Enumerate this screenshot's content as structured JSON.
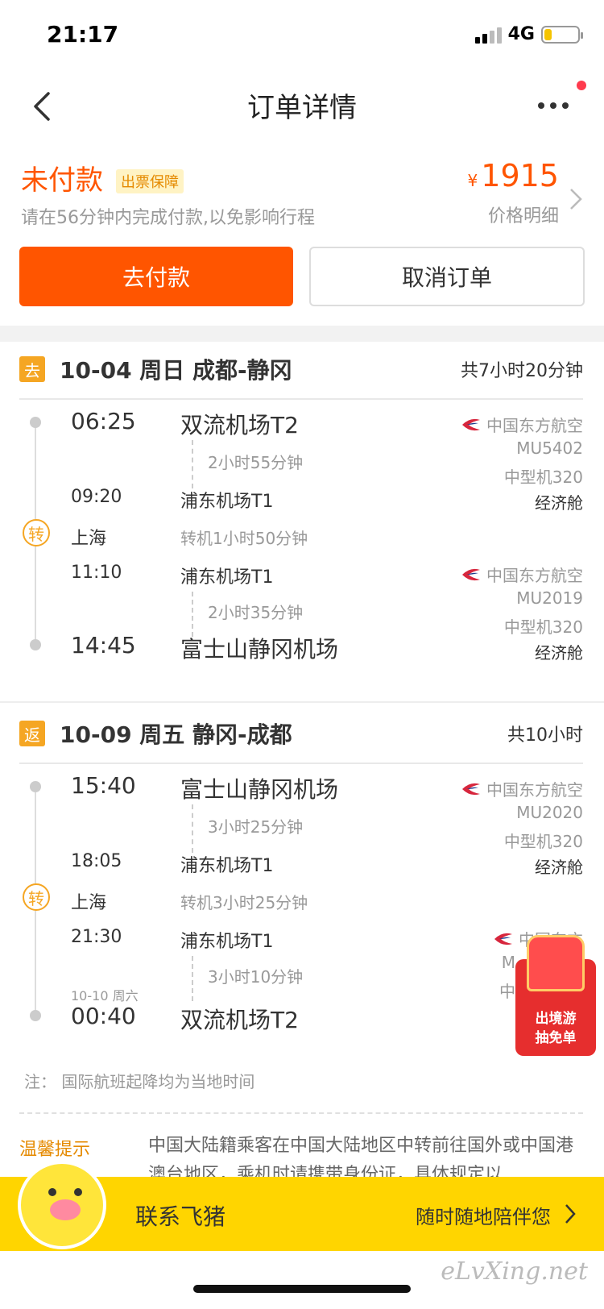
{
  "status_bar": {
    "time": "21:17",
    "network": "4G",
    "battery_level": 0.22
  },
  "nav": {
    "title": "订单详情"
  },
  "order": {
    "status": "未付款",
    "guarantee": "出票保障",
    "pay_hint": "请在56分钟内完成付款,以免影响行程",
    "price_symbol": "¥",
    "price": "1915",
    "price_detail": "价格明细",
    "pay_button": "去付款",
    "cancel_button": "取消订单"
  },
  "outbound": {
    "tag": "去",
    "title": "10-04 周日 成都-静冈",
    "total": "共7小时20分钟",
    "seg1": {
      "dep_time": "06:25",
      "dep_airport": "双流机场T2",
      "duration": "2小时55分钟",
      "arr_time": "09:20",
      "arr_airport": "浦东机场T1",
      "airline": "中国东方航空",
      "flight": "MU5402",
      "aircraft": "中型机320",
      "cabin": "经济舱"
    },
    "transfer": {
      "badge": "转",
      "city": "上海",
      "info": "转机1小时50分钟"
    },
    "seg2": {
      "dep_time": "11:10",
      "dep_airport": "浦东机场T1",
      "duration": "2小时35分钟",
      "arr_time": "14:45",
      "arr_airport": "富士山静冈机场",
      "airline": "中国东方航空",
      "flight": "MU2019",
      "aircraft": "中型机320",
      "cabin": "经济舱"
    }
  },
  "return": {
    "tag": "返",
    "title": "10-09 周五 静冈-成都",
    "total": "共10小时",
    "seg1": {
      "dep_time": "15:40",
      "dep_airport": "富士山静冈机场",
      "duration": "3小时25分钟",
      "arr_time": "18:05",
      "arr_airport": "浦东机场T1",
      "airline": "中国东方航空",
      "flight": "MU2020",
      "aircraft": "中型机320",
      "cabin": "经济舱"
    },
    "transfer": {
      "badge": "转",
      "city": "上海",
      "info": "转机3小时25分钟"
    },
    "seg2": {
      "dep_time": "21:30",
      "dep_airport": "浦东机场T1",
      "duration": "3小时10分钟",
      "arr_date": "10-10 周六",
      "arr_time": "00:40",
      "arr_airport": "双流机场T2",
      "airline": "中国东方",
      "flight_partial": "M",
      "aircraft_partial": "中"
    }
  },
  "note": "注：  国际航班起降均为当地时间",
  "tips": {
    "label": "温馨提示",
    "text": "中国大陆籍乘客在中国大陆地区中转前往国外或中国港澳台地区，乘机时请携带身份证，具体规定以"
  },
  "promo": {
    "line1": "出境游",
    "line2": "抽免单"
  },
  "contact": {
    "title": "联系飞猪",
    "subtitle": "随时随地陪伴您"
  },
  "watermark": "eLvXing.net",
  "colors": {
    "accent": "#ff5500",
    "tag": "#f5a623",
    "contact_bar": "#ffd500"
  }
}
